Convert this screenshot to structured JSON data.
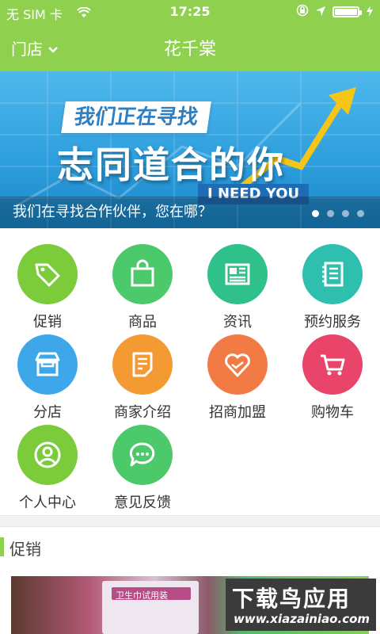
{
  "status_bar": {
    "carrier": "无 SIM 卡",
    "time": "17:25"
  },
  "header": {
    "store_label": "门店",
    "title": "花千棠"
  },
  "banner": {
    "tag_top": "我们正在寻找",
    "headline": "志同道合的你",
    "tag_bottom": "I NEED YOU",
    "caption": "我们在寻找合作伙伴，您在哪？",
    "dots_total": 4,
    "dots_active_index": 0
  },
  "menu": {
    "items": [
      {
        "label": "促销",
        "icon": "tag-icon",
        "color": "#7ccb3a"
      },
      {
        "label": "商品",
        "icon": "shopping-bag-icon",
        "color": "#4cc96a"
      },
      {
        "label": "资讯",
        "icon": "newspaper-icon",
        "color": "#30c08a"
      },
      {
        "label": "预约服务",
        "icon": "notebook-icon",
        "color": "#2fbfae"
      },
      {
        "label": "分店",
        "icon": "storefront-icon",
        "color": "#3ea7e9"
      },
      {
        "label": "商家介绍",
        "icon": "document-icon",
        "color": "#f39a33"
      },
      {
        "label": "招商加盟",
        "icon": "heart-handshake-icon",
        "color": "#f27a45"
      },
      {
        "label": "购物车",
        "icon": "cart-icon",
        "color": "#e9456a"
      },
      {
        "label": "个人中心",
        "icon": "user-icon",
        "color": "#7ccb3a"
      },
      {
        "label": "意见反馈",
        "icon": "chat-bubble-icon",
        "color": "#4cc96a"
      }
    ]
  },
  "section": {
    "title": "促销"
  },
  "product_preview": {
    "text": "卫生巾试用装"
  },
  "watermark": {
    "title": "下载鸟应用",
    "url": "www.xiazainiao.com"
  },
  "colors": {
    "brand_green": "#8fd14f"
  }
}
